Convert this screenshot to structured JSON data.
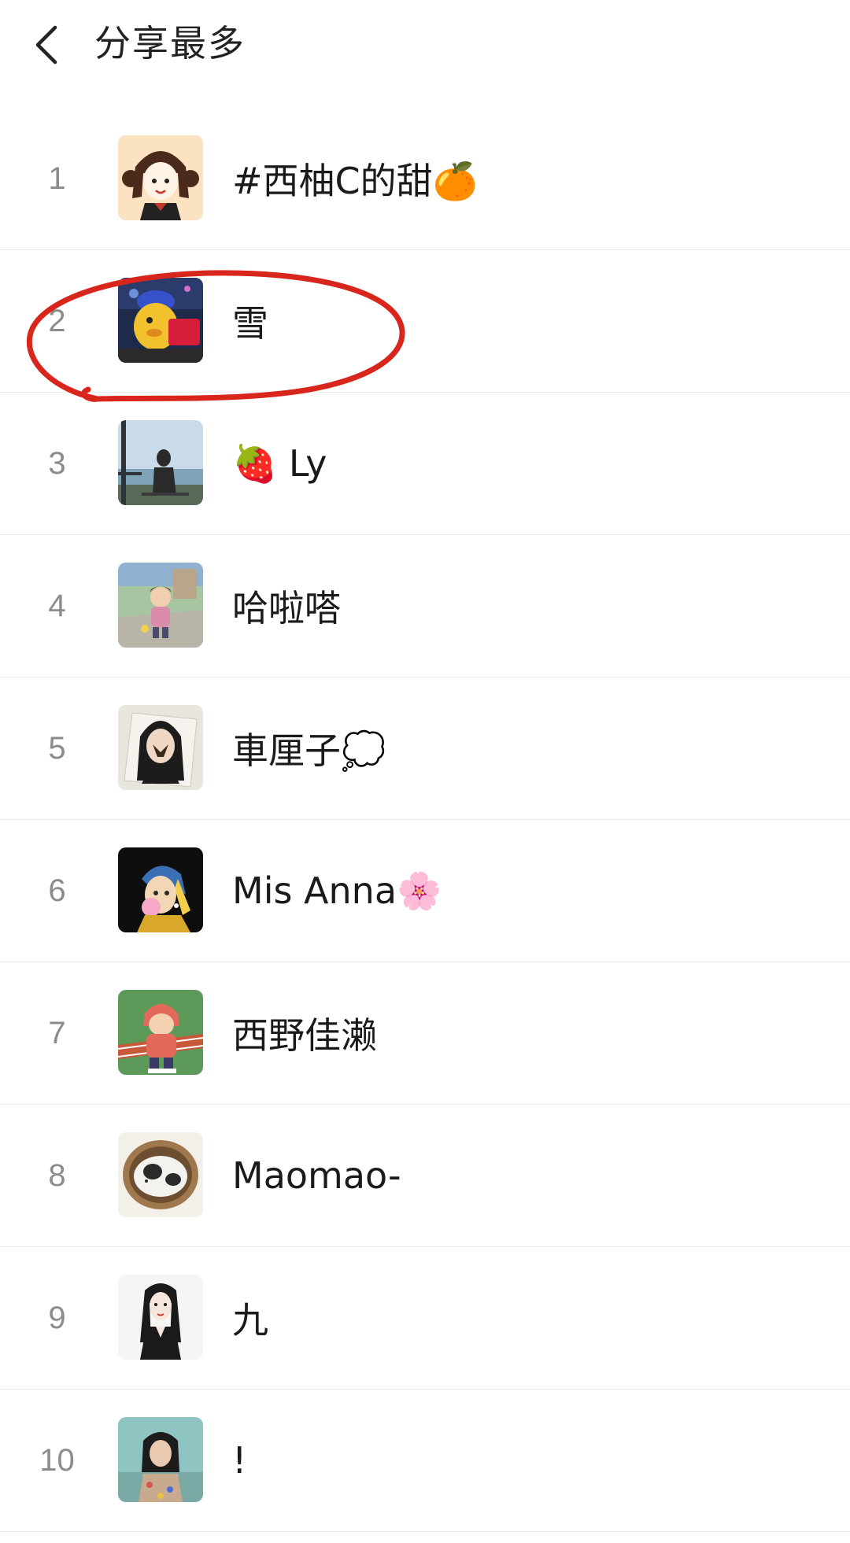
{
  "header": {
    "title": "分享最多",
    "back_icon": "chevron-left-icon"
  },
  "list": {
    "items": [
      {
        "rank": "1",
        "name": "#西柚C的甜🍊",
        "avatar": "avatar-cartoon-girl-pigtails"
      },
      {
        "rank": "2",
        "name": "雪",
        "avatar": "avatar-yellow-duck-costume"
      },
      {
        "rank": "3",
        "name": "🍓 Ly",
        "avatar": "avatar-girl-seaside"
      },
      {
        "rank": "4",
        "name": "哈啦嗒",
        "avatar": "avatar-cartoon-boy-street"
      },
      {
        "rank": "5",
        "name": "車厘子💭",
        "avatar": "avatar-girl-butterfly"
      },
      {
        "rank": "6",
        "name": "Mis Anna🌸",
        "avatar": "avatar-pearl-earring-girl"
      },
      {
        "rank": "7",
        "name": "西野佳濑",
        "avatar": "avatar-cartoon-boy-red-hoodie"
      },
      {
        "rank": "8",
        "name": "Maomao-",
        "avatar": "avatar-cat-in-basket"
      },
      {
        "rank": "9",
        "name": "九",
        "avatar": "avatar-sketch-girl"
      },
      {
        "rank": "10",
        "name": "!",
        "avatar": "avatar-girl-portrait"
      }
    ]
  },
  "annotation": {
    "color": "#d9261c",
    "target_rank": "2"
  }
}
